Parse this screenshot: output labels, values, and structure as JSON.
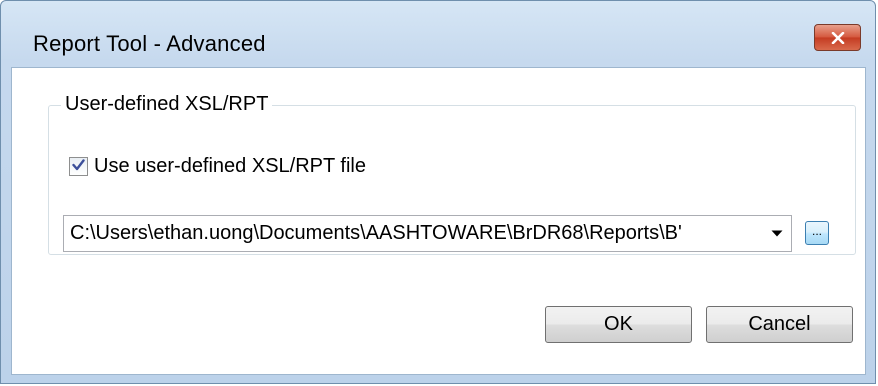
{
  "window": {
    "title": "Report Tool - Advanced",
    "close_icon": "close-icon"
  },
  "group": {
    "legend": "User-defined XSL/RPT",
    "checkbox": {
      "label": "Use user-defined XSL/RPT file",
      "checked": true
    },
    "file_combo": {
      "value": "C:\\Users\\ethan.uong\\Documents\\AASHTOWARE\\BrDR68\\Reports\\B'"
    },
    "browse_label": "..."
  },
  "buttons": {
    "ok_label": "OK",
    "cancel_label": "Cancel"
  },
  "colors": {
    "accent": "#3c7fb1",
    "close_red": "#c43b22",
    "checkmark": "#3c4f9a"
  }
}
